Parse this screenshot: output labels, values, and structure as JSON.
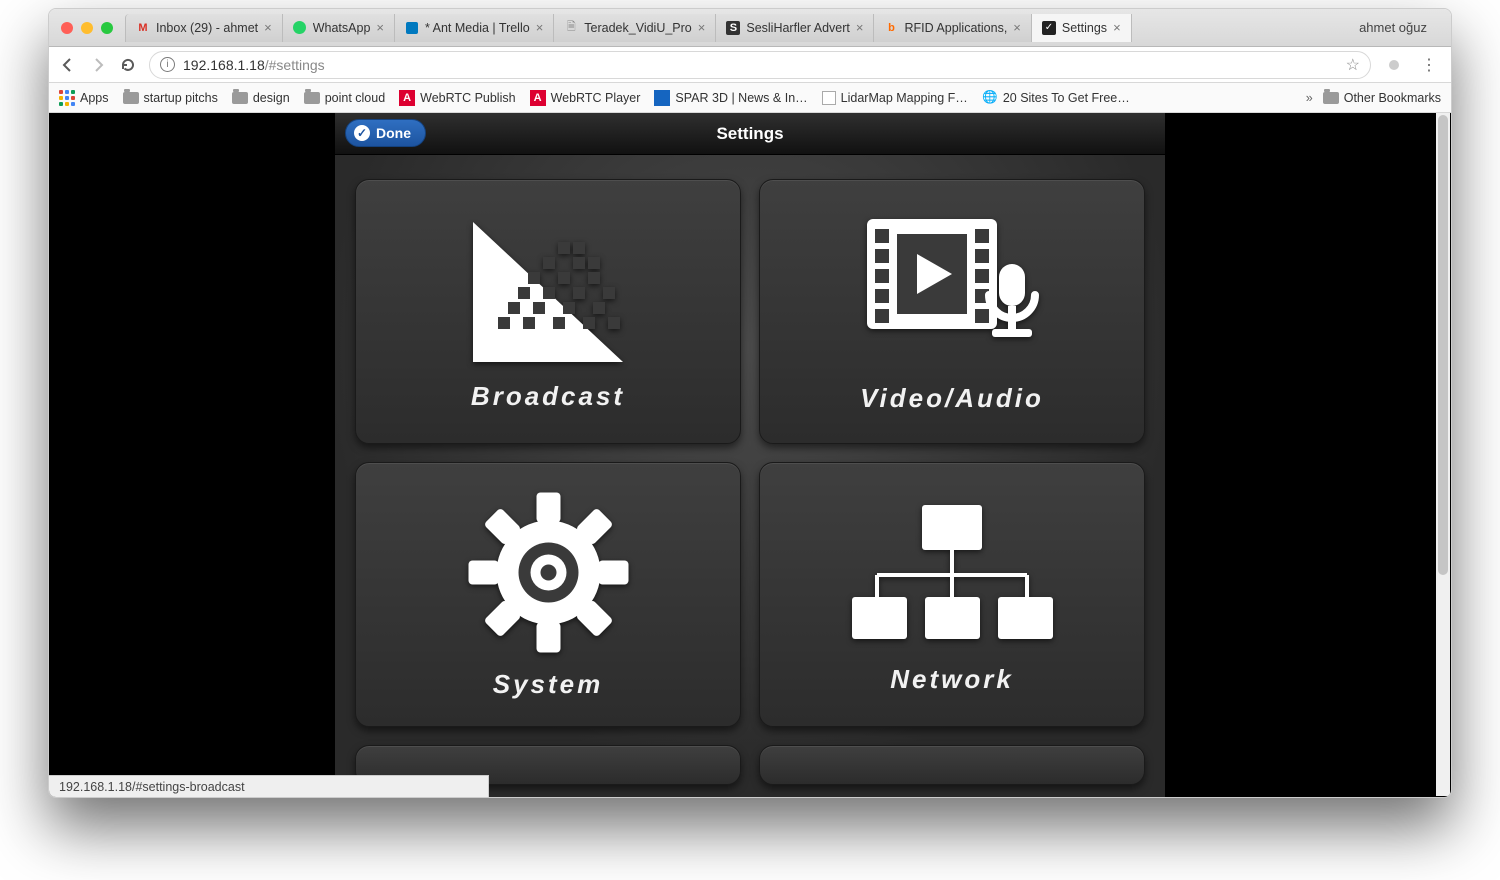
{
  "window": {
    "profile_name": "ahmet oğuz"
  },
  "tabs": [
    {
      "label": "Inbox (29) - ahmet",
      "favicon": "gmail"
    },
    {
      "label": "WhatsApp",
      "favicon": "whatsapp"
    },
    {
      "label": "* Ant Media | Trello",
      "favicon": "trello"
    },
    {
      "label": "Teradek_VidiU_Pro",
      "favicon": "doc"
    },
    {
      "label": "SesliHarfler Advert",
      "favicon": "s"
    },
    {
      "label": "RFID Applications,",
      "favicon": "b"
    },
    {
      "label": "Settings",
      "favicon": "v",
      "active": true
    }
  ],
  "address": {
    "host": "192.168.1.18",
    "path": "/#settings"
  },
  "bookmarks": {
    "items": [
      {
        "label": "Apps",
        "icon": "apps"
      },
      {
        "label": "startup pitchs",
        "icon": "folder"
      },
      {
        "label": "design",
        "icon": "folder"
      },
      {
        "label": "point cloud",
        "icon": "folder"
      },
      {
        "label": "WebRTC Publish",
        "icon": "angular"
      },
      {
        "label": "WebRTC Player",
        "icon": "angular"
      },
      {
        "label": "SPAR 3D | News & In…",
        "icon": "spar"
      },
      {
        "label": "LidarMap Mapping F…",
        "icon": "lidar"
      },
      {
        "label": "20 Sites To Get Free…",
        "icon": "globe"
      }
    ],
    "overflow": "»",
    "other": "Other Bookmarks"
  },
  "settings": {
    "title": "Settings",
    "done": "Done",
    "tiles": [
      {
        "id": "broadcast",
        "label": "Broadcast"
      },
      {
        "id": "video_audio",
        "label": "Video/Audio"
      },
      {
        "id": "system",
        "label": "System"
      },
      {
        "id": "network",
        "label": "Network"
      }
    ]
  },
  "status_url": "192.168.1.18/#settings-broadcast"
}
